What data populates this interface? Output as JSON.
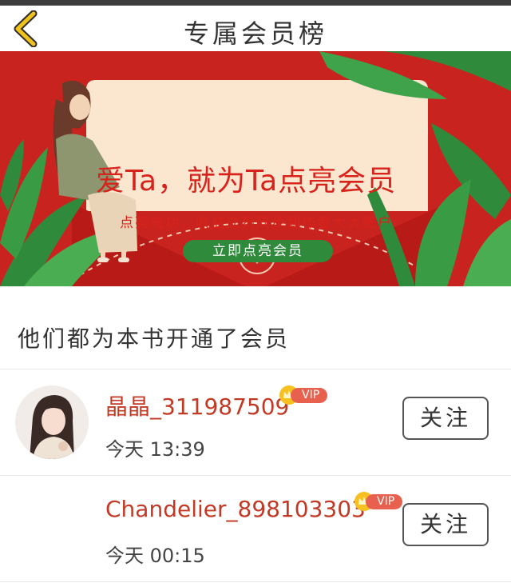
{
  "nav": {
    "title": "专属会员榜",
    "back_icon": "chevron-left-icon",
    "back_color": "#f0c21b"
  },
  "banner": {
    "headline": "爱Ta，就为Ta点亮会员",
    "subtitle": "点亮成功，收益立刻同步到作者大大账户",
    "cta_label": "立即点亮会员",
    "colors": {
      "background": "#c9231f",
      "card": "#fbe6cf",
      "text": "#d7231c",
      "cta": "#2f8a3b"
    }
  },
  "section": {
    "title": "他们都为本书开通了会员"
  },
  "members": [
    {
      "name": "晶晶_311987509",
      "badge": "VIP",
      "time": "今天  13:39",
      "follow_label": "关注",
      "has_avatar": true
    },
    {
      "name": "Chandelier_898103303",
      "badge": "VIP",
      "time": "今天  00:15",
      "follow_label": "关注",
      "has_avatar": false
    }
  ]
}
